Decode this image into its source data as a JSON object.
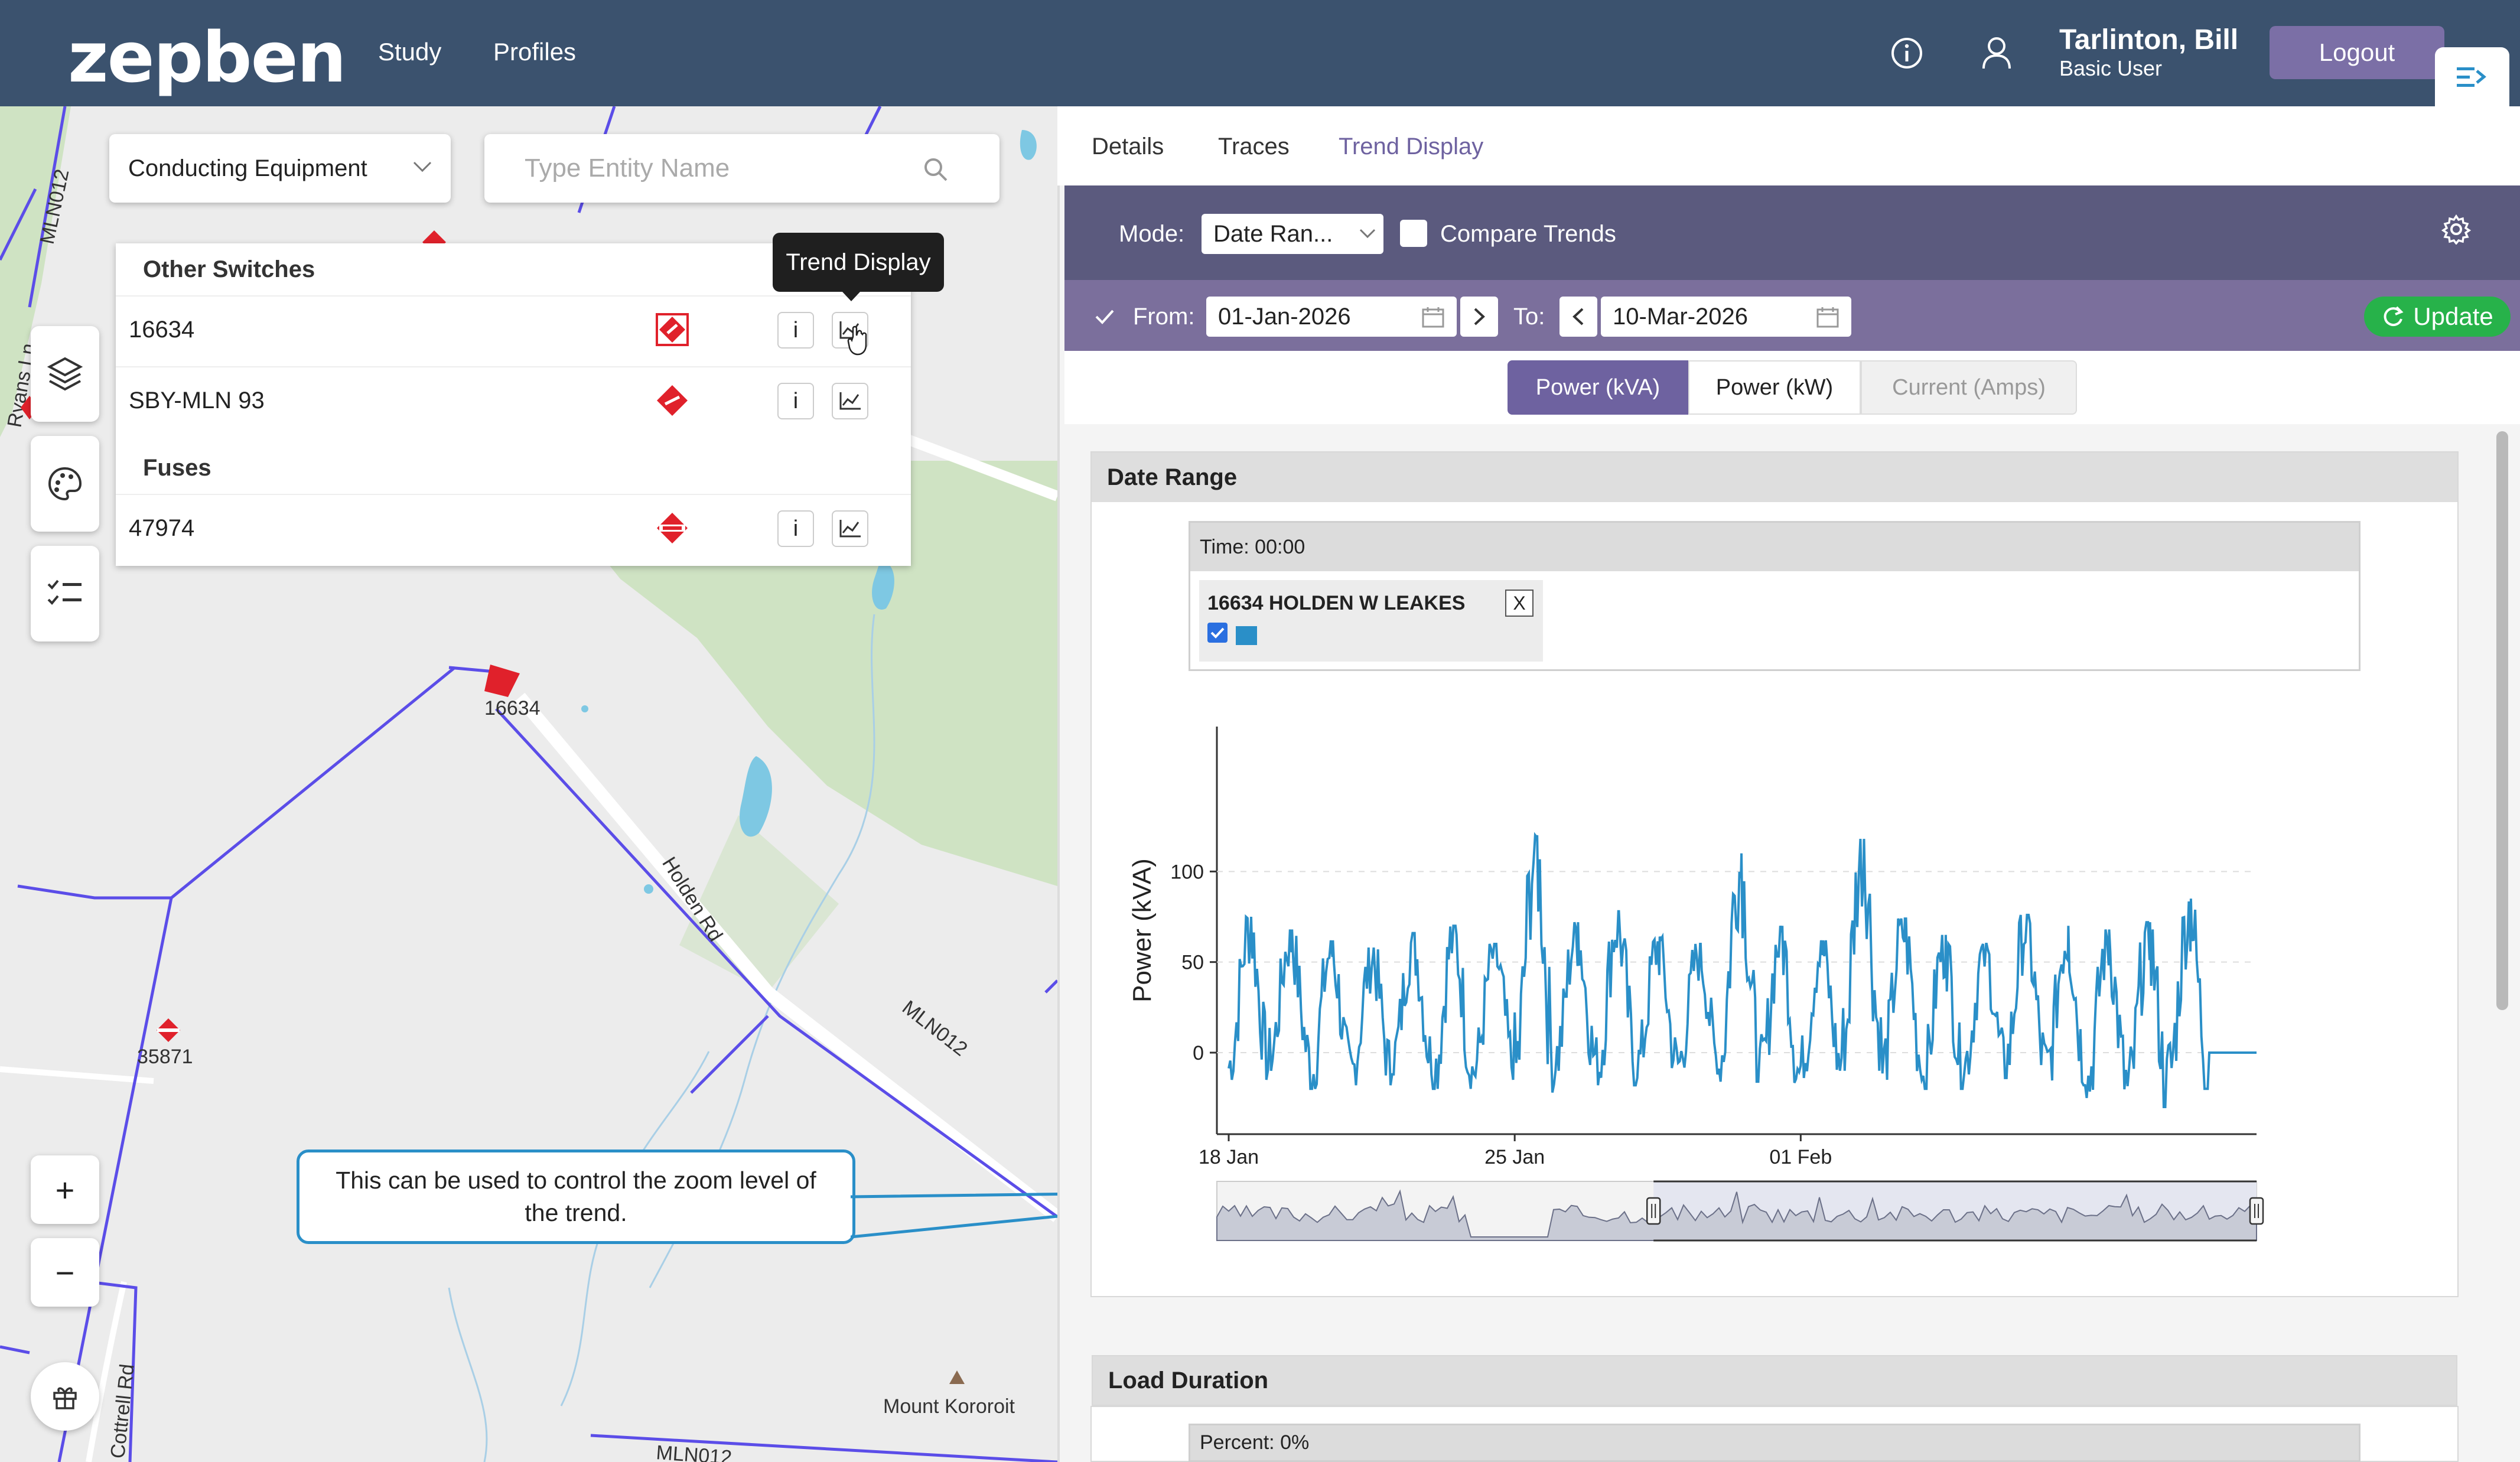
{
  "app": {
    "logo": "zepben",
    "nav": [
      "Study",
      "Profiles"
    ],
    "user": {
      "name": "Tarlinton, Bill",
      "role": "Basic User"
    },
    "logout_label": "Logout"
  },
  "map": {
    "entity_type": "Conducting Equipment",
    "search_placeholder": "Type Entity Name",
    "tooltip": "Trend Display",
    "groups": [
      {
        "title": "Other Switches",
        "items": [
          "16634",
          "SBY-MLN 93"
        ]
      },
      {
        "title": "Fuses",
        "items": [
          "47974"
        ]
      }
    ],
    "info_label": "i",
    "labels": {
      "road_holden": "Holden Rd",
      "line_mln012": "MLN012",
      "line_mln012_b": "MLN012",
      "line_mln012_c": "MLN012",
      "road_ryans": "Ryans Ln",
      "road_cottrell": "Cottrell Rd",
      "peak": "Mount Kororoit",
      "asset_16634": "16634",
      "asset_35871": "35871"
    },
    "zoom_in": "+",
    "zoom_out": "−",
    "callout": "This can be used to control the zoom level of the trend."
  },
  "panel": {
    "tabs": [
      "Details",
      "Traces",
      "Trend Display"
    ],
    "active_tab": "Trend Display",
    "mode_label": "Mode:",
    "mode_value": "Date Ran...",
    "compare_label": "Compare Trends",
    "from_label": "From:",
    "from_value": "01-Jan-2026",
    "to_label": "To:",
    "to_value": "10-Mar-2026",
    "update_label": "Update",
    "units": [
      "Power (kVA)",
      "Power (kW)",
      "Current (Amps)"
    ],
    "active_unit": "Power (kVA)",
    "date_range_title": "Date Range",
    "time_label": "Time: 00:00",
    "series_label": "16634 HOLDEN W LEAKES",
    "remove_label": "X",
    "load_duration_title": "Load Duration",
    "percent_label": "Percent: 0%"
  },
  "colors": {
    "topbar": "#3b526e",
    "mode_bar": "#5b5a7e",
    "date_bar": "#7b6f9c",
    "update": "#27b24a",
    "series": "#2a8fc8",
    "logout": "#7b6fa6"
  },
  "chart_data": {
    "type": "line",
    "ylabel": "Power (kVA)",
    "yticks": [
      0,
      50,
      100
    ],
    "xticks": [
      "18 Jan",
      "25 Jan",
      "01 Feb"
    ],
    "series": [
      {
        "name": "16634 HOLDEN W LEAKES"
      }
    ],
    "x_dates": [
      "2026-01-18",
      "2026-01-19",
      "2026-01-20",
      "2026-01-21",
      "2026-01-22",
      "2026-01-23",
      "2026-01-24",
      "2026-01-25",
      "2026-01-26",
      "2026-01-27",
      "2026-01-28",
      "2026-01-29",
      "2026-01-30",
      "2026-01-31",
      "2026-02-01",
      "2026-02-02",
      "2026-02-03",
      "2026-02-04",
      "2026-02-05",
      "2026-02-06",
      "2026-02-07",
      "2026-02-08",
      "2026-02-09",
      "2026-02-10",
      "2026-02-11"
    ],
    "peaks": [
      75,
      68,
      62,
      58,
      66,
      70,
      60,
      120,
      72,
      78,
      64,
      60,
      110,
      70,
      62,
      118,
      74,
      65,
      60,
      76,
      70,
      68,
      72,
      85,
      90
    ],
    "troughs": [
      -15,
      -10,
      -20,
      -18,
      -12,
      -20,
      -15,
      -22,
      -10,
      -18,
      -14,
      -12,
      -16,
      -20,
      -14,
      -10,
      -15,
      -20,
      -12,
      -14,
      -18,
      -25,
      -30,
      -20,
      -10
    ],
    "tail_value": 0,
    "ylim": [
      -45,
      180
    ]
  }
}
